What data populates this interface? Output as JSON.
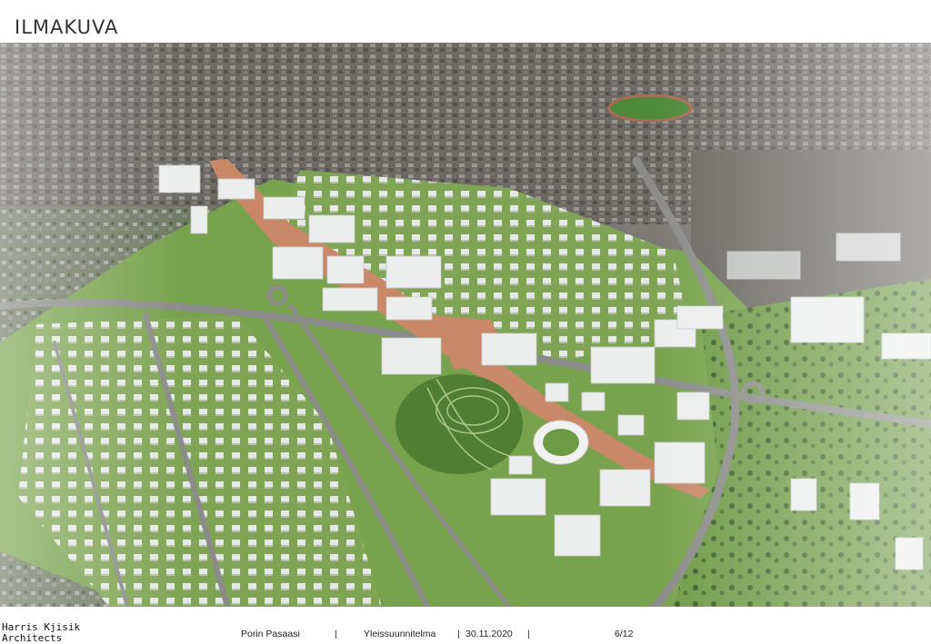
{
  "page": {
    "title": "ILMAKUVA"
  },
  "footer": {
    "logo_line1": "Harris Kjisik",
    "logo_line2": "Architects",
    "project": "Porin Pasaasi",
    "sep1": "|",
    "phase": "Yleissuunnitelma",
    "sep2": "|",
    "date": "30.11.2020",
    "sep3": "|",
    "page_number": "6/12"
  },
  "colors": {
    "park": "#5f8f3a",
    "grass": "#7aa64c",
    "plaza": "#c98a6a",
    "city": "#6e6a66",
    "road": "#8a8a88",
    "building": "#e9ebea"
  }
}
